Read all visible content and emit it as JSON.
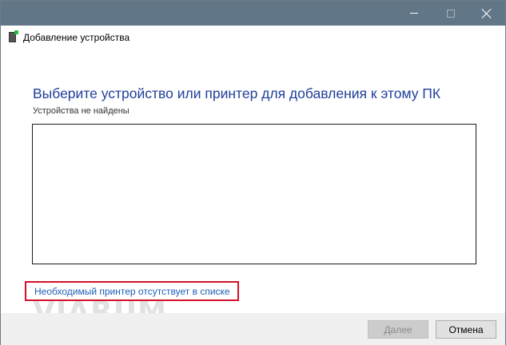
{
  "window": {
    "title": "Добавление устройства"
  },
  "main": {
    "heading": "Выберите устройство или принтер для добавления к этому ПК",
    "status": "Устройства не найдены",
    "missing_printer_link": "Необходимый принтер отсутствует в списке"
  },
  "watermark": "VIARUM",
  "footer": {
    "next_label": "Далее",
    "cancel_label": "Отмена"
  },
  "colors": {
    "titlebar": "#617686",
    "heading": "#1f3f9a",
    "link": "#1e5fb8",
    "highlight": "#d4102a"
  }
}
